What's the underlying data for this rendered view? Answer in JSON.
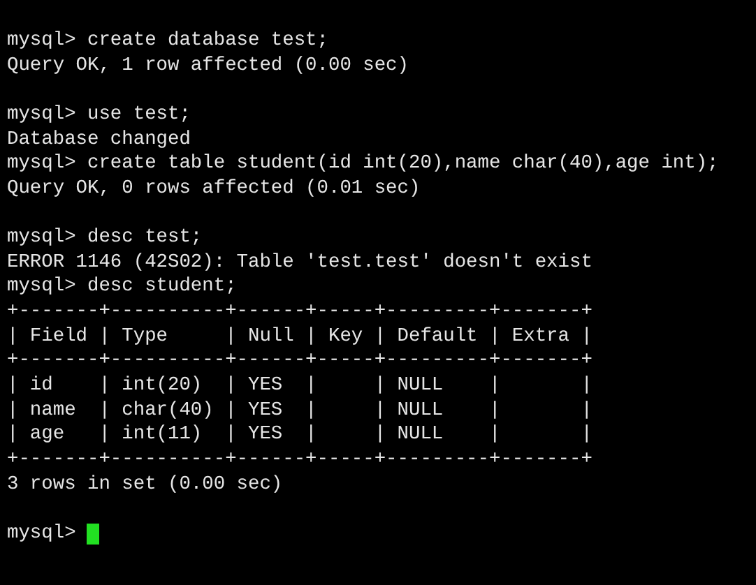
{
  "terminal": {
    "lines": [
      {
        "kind": "text",
        "text": "mysql> create database test;"
      },
      {
        "kind": "text",
        "text": "Query OK, 1 row affected (0.00 sec)"
      },
      {
        "kind": "blank"
      },
      {
        "kind": "text",
        "text": "mysql> use test;"
      },
      {
        "kind": "text",
        "text": "Database changed"
      },
      {
        "kind": "text",
        "text": "mysql> create table student(id int(20),name char(40),age int);"
      },
      {
        "kind": "text",
        "text": "Query OK, 0 rows affected (0.01 sec)"
      },
      {
        "kind": "blank"
      },
      {
        "kind": "text",
        "text": "mysql> desc test;"
      },
      {
        "kind": "text",
        "text": "ERROR 1146 (42S02): Table 'test.test' doesn't exist"
      },
      {
        "kind": "text",
        "text": "mysql> desc student;"
      },
      {
        "kind": "text",
        "text": "+-------+----------+------+-----+---------+-------+"
      },
      {
        "kind": "text",
        "text": "| Field | Type     | Null | Key | Default | Extra |"
      },
      {
        "kind": "text",
        "text": "+-------+----------+------+-----+---------+-------+"
      },
      {
        "kind": "text",
        "text": "| id    | int(20)  | YES  |     | NULL    |       |"
      },
      {
        "kind": "text",
        "text": "| name  | char(40) | YES  |     | NULL    |       |"
      },
      {
        "kind": "text",
        "text": "| age   | int(11)  | YES  |     | NULL    |       |"
      },
      {
        "kind": "text",
        "text": "+-------+----------+------+-----+---------+-------+"
      },
      {
        "kind": "text",
        "text": "3 rows in set (0.00 sec)"
      },
      {
        "kind": "blank"
      },
      {
        "kind": "prompt",
        "text": "mysql>",
        "cursor": true
      }
    ]
  }
}
